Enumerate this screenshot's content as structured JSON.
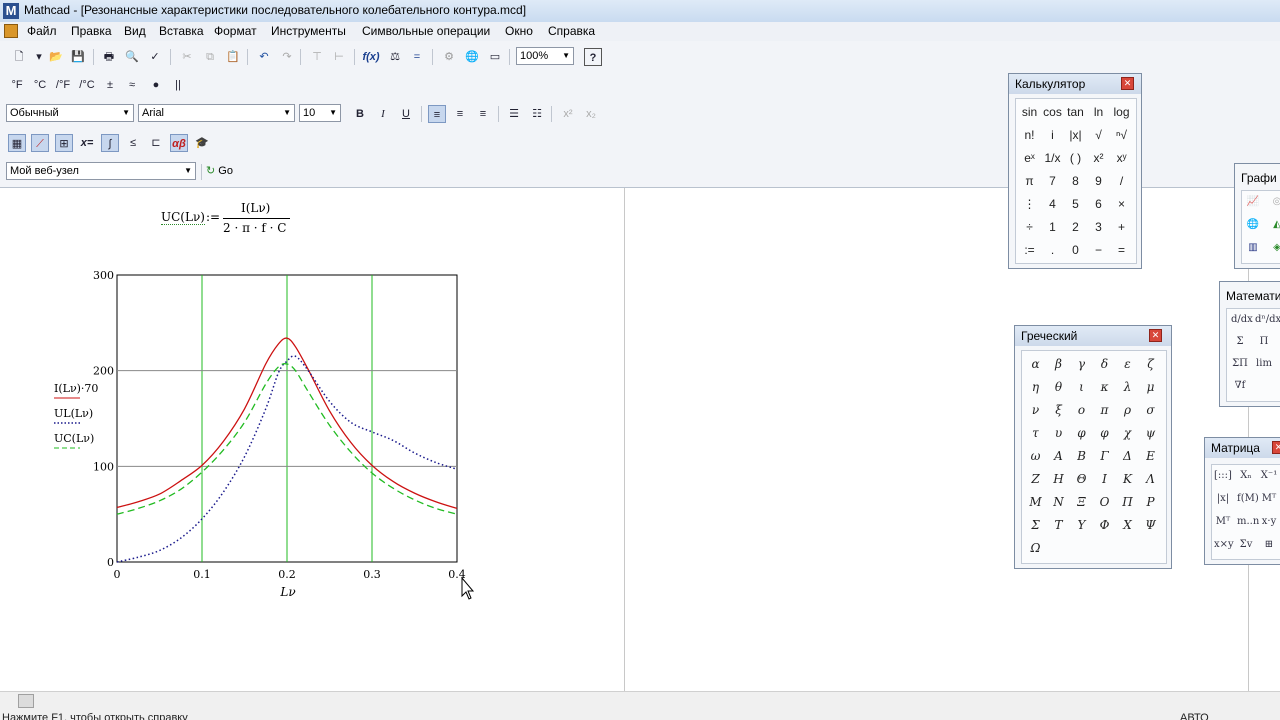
{
  "app": {
    "title": "Mathcad - [Резонансные характеристики последовательного колебательного контура.mcd]",
    "icon": "mathcad-logo-icon"
  },
  "menu": [
    "Файл",
    "Правка",
    "Вид",
    "Вставка",
    "Формат",
    "Инструменты",
    "Символьные операции",
    "Окно",
    "Справка"
  ],
  "toolbar": {
    "zoom": "100%",
    "units_row": [
      "°F",
      "°C",
      "/°F",
      "/°C",
      "±",
      "≈",
      "●",
      "||"
    ],
    "style": "Обычный",
    "font": "Arial",
    "font_size": "10",
    "bold": "B",
    "italic": "I",
    "underline": "U",
    "superscript": "x²",
    "subscript": "x₂",
    "math_defs": "x=",
    "web_address": "Мой веб-узел",
    "go_label": "Go"
  },
  "formula": {
    "lhs": "UC(Lν)",
    "assign": ":=",
    "numerator": "I(Lν)",
    "denominator": "2 · π · f · C"
  },
  "chart_data": {
    "type": "line",
    "xlabel": "Lν",
    "xlim": [
      0,
      0.4
    ],
    "ylim": [
      0,
      300
    ],
    "xticks": [
      "0",
      "0.1",
      "0.2",
      "0.3",
      "0.4"
    ],
    "yticks": [
      "0",
      "100",
      "200",
      "300"
    ],
    "ylabels": [
      "I(Lν)·70",
      "UL(Lν)",
      "UC(Lν)"
    ],
    "colors": {
      "I": "#cc1111",
      "UL": "#1a1a8c",
      "UC": "#22bb22",
      "vgrid": "#22bb22",
      "hgrid": "#888888"
    },
    "series": [
      {
        "name": "I(Lν)·70",
        "style": "solid",
        "x": [
          0,
          0.025,
          0.05,
          0.075,
          0.1,
          0.125,
          0.15,
          0.175,
          0.19,
          0.2,
          0.21,
          0.225,
          0.25,
          0.275,
          0.3,
          0.325,
          0.35,
          0.375,
          0.4
        ],
        "y": [
          57,
          63,
          71,
          85,
          101,
          126,
          160,
          207,
          228,
          234,
          225,
          201,
          158,
          125,
          101,
          84,
          72,
          63,
          56
        ]
      },
      {
        "name": "UL(Lν)",
        "style": "dotted",
        "x": [
          0,
          0.025,
          0.05,
          0.075,
          0.1,
          0.125,
          0.15,
          0.175,
          0.19,
          0.2,
          0.21,
          0.225,
          0.25,
          0.275,
          0.3,
          0.325,
          0.35,
          0.375,
          0.4
        ],
        "y": [
          0,
          5,
          12,
          25,
          45,
          73,
          110,
          160,
          198,
          210,
          215,
          200,
          168,
          146,
          136,
          127,
          114,
          104,
          97
        ]
      },
      {
        "name": "UC(Lν)",
        "style": "dashed",
        "x": [
          0,
          0.025,
          0.05,
          0.075,
          0.1,
          0.125,
          0.15,
          0.175,
          0.19,
          0.2,
          0.21,
          0.225,
          0.25,
          0.275,
          0.3,
          0.325,
          0.35,
          0.375,
          0.4
        ],
        "y": [
          50,
          56,
          64,
          76,
          94,
          117,
          146,
          186,
          204,
          207,
          200,
          178,
          143,
          115,
          93,
          77,
          65,
          56,
          50
        ]
      }
    ]
  },
  "calculator": {
    "title": "Калькулятор",
    "rows": [
      [
        "sin",
        "cos",
        "tan",
        "ln",
        "log"
      ],
      [
        "n!",
        "i",
        "|x|",
        "√",
        "ⁿ√"
      ],
      [
        "eˣ",
        "1/x",
        "( )",
        "x²",
        "xʸ"
      ],
      [
        "π",
        "7",
        "8",
        "9",
        "/"
      ],
      [
        "⋮",
        "4",
        "5",
        "6",
        "×"
      ],
      [
        "÷",
        "1",
        "2",
        "3",
        "+"
      ],
      [
        ":=",
        ".",
        "0",
        "−",
        "="
      ]
    ]
  },
  "greek": {
    "title": "Греческий",
    "rows": [
      [
        "α",
        "β",
        "γ",
        "δ",
        "ε",
        "ζ"
      ],
      [
        "η",
        "θ",
        "ι",
        "κ",
        "λ",
        "μ"
      ],
      [
        "ν",
        "ξ",
        "ο",
        "π",
        "ρ",
        "σ"
      ],
      [
        "τ",
        "υ",
        "φ",
        "φ",
        "χ",
        "ψ"
      ],
      [
        "ω",
        "Α",
        "Β",
        "Γ",
        "Δ",
        "Ε"
      ],
      [
        "Ζ",
        "Η",
        "Θ",
        "Ι",
        "Κ",
        "Λ"
      ],
      [
        "Μ",
        "Ν",
        "Ξ",
        "Ο",
        "Π",
        "Ρ"
      ],
      [
        "Σ",
        "Τ",
        "Υ",
        "Φ",
        "Χ",
        "Ψ"
      ],
      [
        "Ω"
      ]
    ]
  },
  "graph_palette": {
    "title": "Графи"
  },
  "calculus_palette": {
    "title": "Математи",
    "items": [
      "d/dx",
      "dⁿ/dxⁿ",
      "Σ",
      "Π",
      "ΣΠ",
      "lim",
      "∇f"
    ]
  },
  "matrix_palette": {
    "title": "Матрица",
    "items": [
      "[:::]",
      "Xₙ",
      "X⁻¹",
      "|x|",
      "f(M)",
      "Mᵀ",
      "Mᵀ",
      "m..n",
      "x·y",
      "x×y",
      "Σv",
      "⊞"
    ]
  },
  "status": {
    "hint": "Нажмите F1, чтобы открыть справку",
    "mode": "АВТО"
  }
}
